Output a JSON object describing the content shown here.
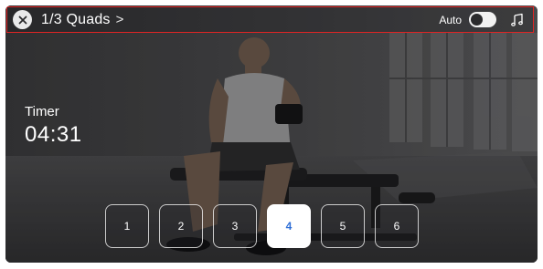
{
  "header": {
    "title": "1/3 Quads",
    "chevron": ">",
    "auto_label": "Auto",
    "auto_enabled": false,
    "close_icon": "close-icon",
    "music_icon": "music-note-icon"
  },
  "timer": {
    "label": "Timer",
    "value": "04:31"
  },
  "sets": {
    "items": [
      {
        "label": "1"
      },
      {
        "label": "2"
      },
      {
        "label": "3"
      },
      {
        "label": "4"
      },
      {
        "label": "5"
      },
      {
        "label": "6"
      }
    ],
    "selected": "4",
    "selected_color": "#2f6fd6"
  },
  "colors": {
    "highlight_border": "#e02424"
  }
}
